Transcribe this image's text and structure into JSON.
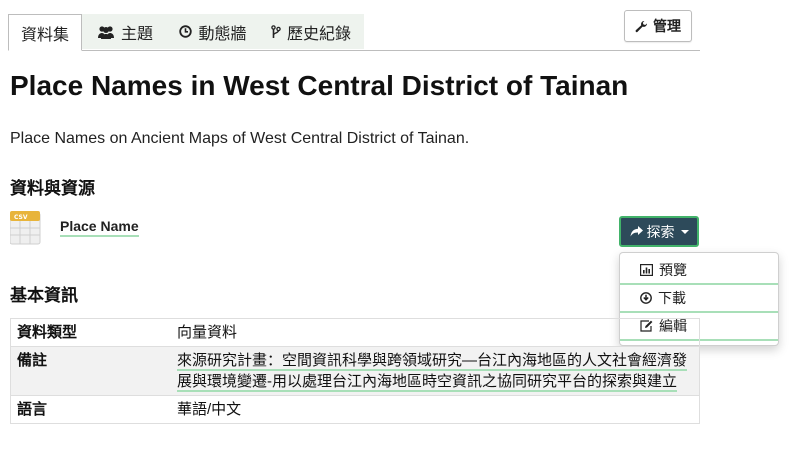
{
  "tabs": [
    {
      "label": "資料集",
      "icon": "",
      "active": true
    },
    {
      "label": "主題",
      "icon": "users-icon"
    },
    {
      "label": "動態牆",
      "icon": "clock-icon"
    },
    {
      "label": "歷史紀錄",
      "icon": "branch-icon"
    }
  ],
  "manage_button": {
    "label": "管理",
    "icon": "wrench-icon"
  },
  "title": "Place Names in West Central District of Tainan",
  "description": "Place Names on Ancient Maps of West Central District of Tainan.",
  "resources": {
    "heading": "資料與資源",
    "items": [
      {
        "name": "Place Name",
        "format": "CSV",
        "explore_label": "探索"
      }
    ]
  },
  "dropdown": {
    "items": [
      {
        "label": "預覽",
        "icon": "chart-icon"
      },
      {
        "label": "下載",
        "icon": "download-icon"
      },
      {
        "label": "編輯",
        "icon": "edit-icon"
      }
    ]
  },
  "info": {
    "heading": "基本資訊",
    "rows": [
      {
        "key": "資料類型",
        "value": "向量資料"
      },
      {
        "key": "備註",
        "value": "來源研究計畫：空間資訊科學與跨領域研究—台江內海地區的人文社會經濟發展與環境變遷-用以處理台江內海地區時空資訊之協同研究平台的探索與建立"
      },
      {
        "key": "語言",
        "value": "華語/中文"
      }
    ]
  },
  "colors": {
    "accent_green": "#42b36a",
    "explore_bg": "#2d4a5a",
    "link_underline": "#a8dfb8"
  }
}
